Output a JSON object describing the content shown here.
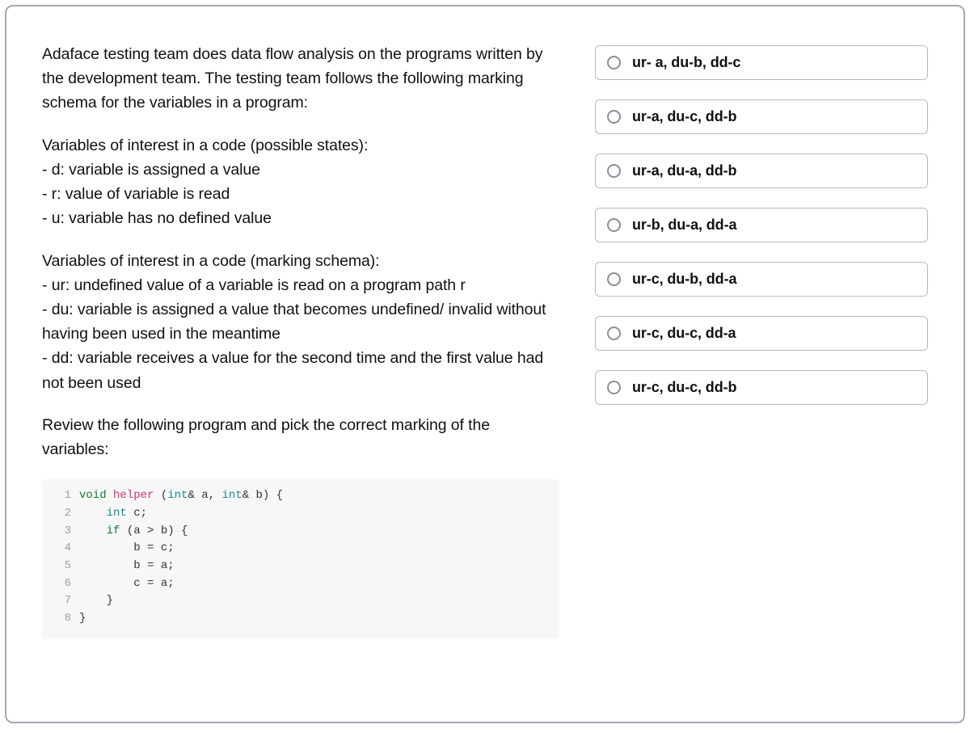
{
  "question": {
    "p1": "Adaface testing team does data flow analysis on the programs written by the development team. The testing team follows the following marking schema for the variables in a program:",
    "p2": "Variables of interest in a code (possible states):\n- d: variable is assigned a value\n- r: value of variable is read\n- u: variable has no defined value",
    "p3": "Variables of interest in a code (marking schema):\n- ur: undefined value of a variable is read on a program path r\n- du: variable is assigned a value that becomes undefined/ invalid without having been used in the meantime\n- dd: variable receives a value for the second time and the first value had not been used",
    "p4": "Review the following program and pick the correct marking of the variables:"
  },
  "code": {
    "lines": [
      {
        "n": "1",
        "html": "<span class=\"kw\">void</span> <span class=\"fn\">helper</span> (<span class=\"typ\">int</span>&amp; a, <span class=\"typ\">int</span>&amp; b) {"
      },
      {
        "n": "2",
        "html": "    <span class=\"typ\">int</span> c;"
      },
      {
        "n": "3",
        "html": "    <span class=\"kw\">if</span> (a &gt; b) {"
      },
      {
        "n": "4",
        "html": "        b = c;"
      },
      {
        "n": "5",
        "html": "        b = a;"
      },
      {
        "n": "6",
        "html": "        c = a;"
      },
      {
        "n": "7",
        "html": "    }"
      },
      {
        "n": "8",
        "html": "}"
      }
    ]
  },
  "options": [
    {
      "label": "ur- a, du-b, dd-c"
    },
    {
      "label": "ur-a, du-c, dd-b"
    },
    {
      "label": "ur-a, du-a, dd-b"
    },
    {
      "label": "ur-b, du-a, dd-a"
    },
    {
      "label": "ur-c, du-b, dd-a"
    },
    {
      "label": "ur-c, du-c, dd-a"
    },
    {
      "label": "ur-c, du-c, dd-b"
    }
  ]
}
